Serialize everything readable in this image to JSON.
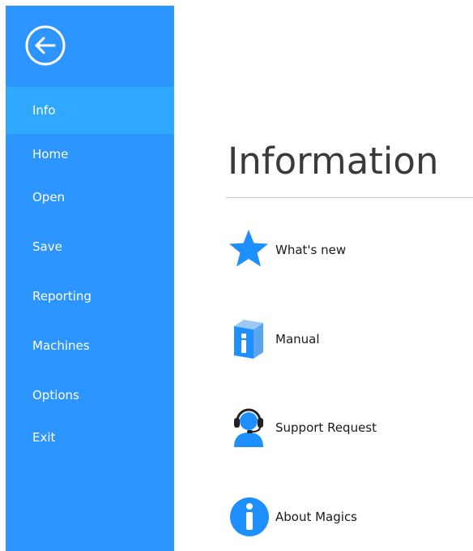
{
  "sidebar": {
    "items": [
      {
        "label": "Info"
      },
      {
        "label": "Home"
      },
      {
        "label": "Open"
      },
      {
        "label": "Save"
      },
      {
        "label": "Reporting"
      },
      {
        "label": "Machines"
      },
      {
        "label": "Options"
      },
      {
        "label": "Exit"
      }
    ],
    "active_index": 0
  },
  "main": {
    "title": "Information",
    "actions": [
      {
        "label": "What's new",
        "icon": "star-icon"
      },
      {
        "label": "Manual",
        "icon": "manual-book-icon"
      },
      {
        "label": "Support Request",
        "icon": "headset-support-icon"
      },
      {
        "label": "About Magics",
        "icon": "info-icon"
      }
    ]
  },
  "colors": {
    "sidebar_bg": "#2d95ff",
    "active_item_bg": "#2fa9ff",
    "icon_blue": "#1e90ff"
  }
}
